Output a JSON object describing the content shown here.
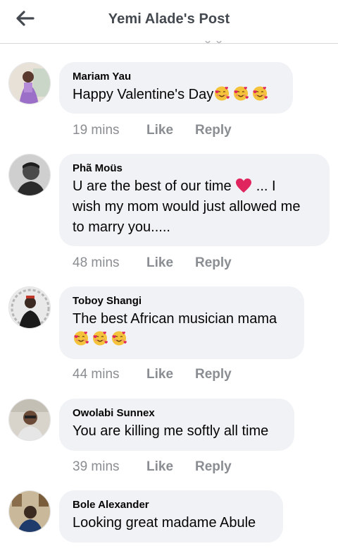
{
  "header": {
    "title": "Yemi Alade's Post",
    "back_icon": "arrow-left-icon"
  },
  "colors": {
    "bubble": "#f0f2f5",
    "meta_text": "#8a8d91",
    "heart": "#e0245e"
  },
  "comments": [
    {
      "author": "Mariam Yau",
      "text": "Happy Valentine's Day",
      "emoji_count": 3,
      "time": "19 mins",
      "like": "Like",
      "reply": "Reply"
    },
    {
      "author": "Phã Moüs",
      "line1": "U are the best of our time",
      "line1_suffix": "... I",
      "line2": "wish my mom would just allowed me",
      "line3": "to marry you.....",
      "time": "48 mins",
      "like": "Like",
      "reply": "Reply"
    },
    {
      "author": "Toboy Shangi",
      "text": "The best African musician mama",
      "emoji_count": 3,
      "time": "44 mins",
      "like": "Like",
      "reply": "Reply"
    },
    {
      "author": "Owolabi Sunnex",
      "text": "You are killing me softly all time",
      "time": "39 mins",
      "like": "Like",
      "reply": "Reply"
    },
    {
      "author": "Bole Alexander",
      "text": "Looking great madame Abule"
    }
  ]
}
